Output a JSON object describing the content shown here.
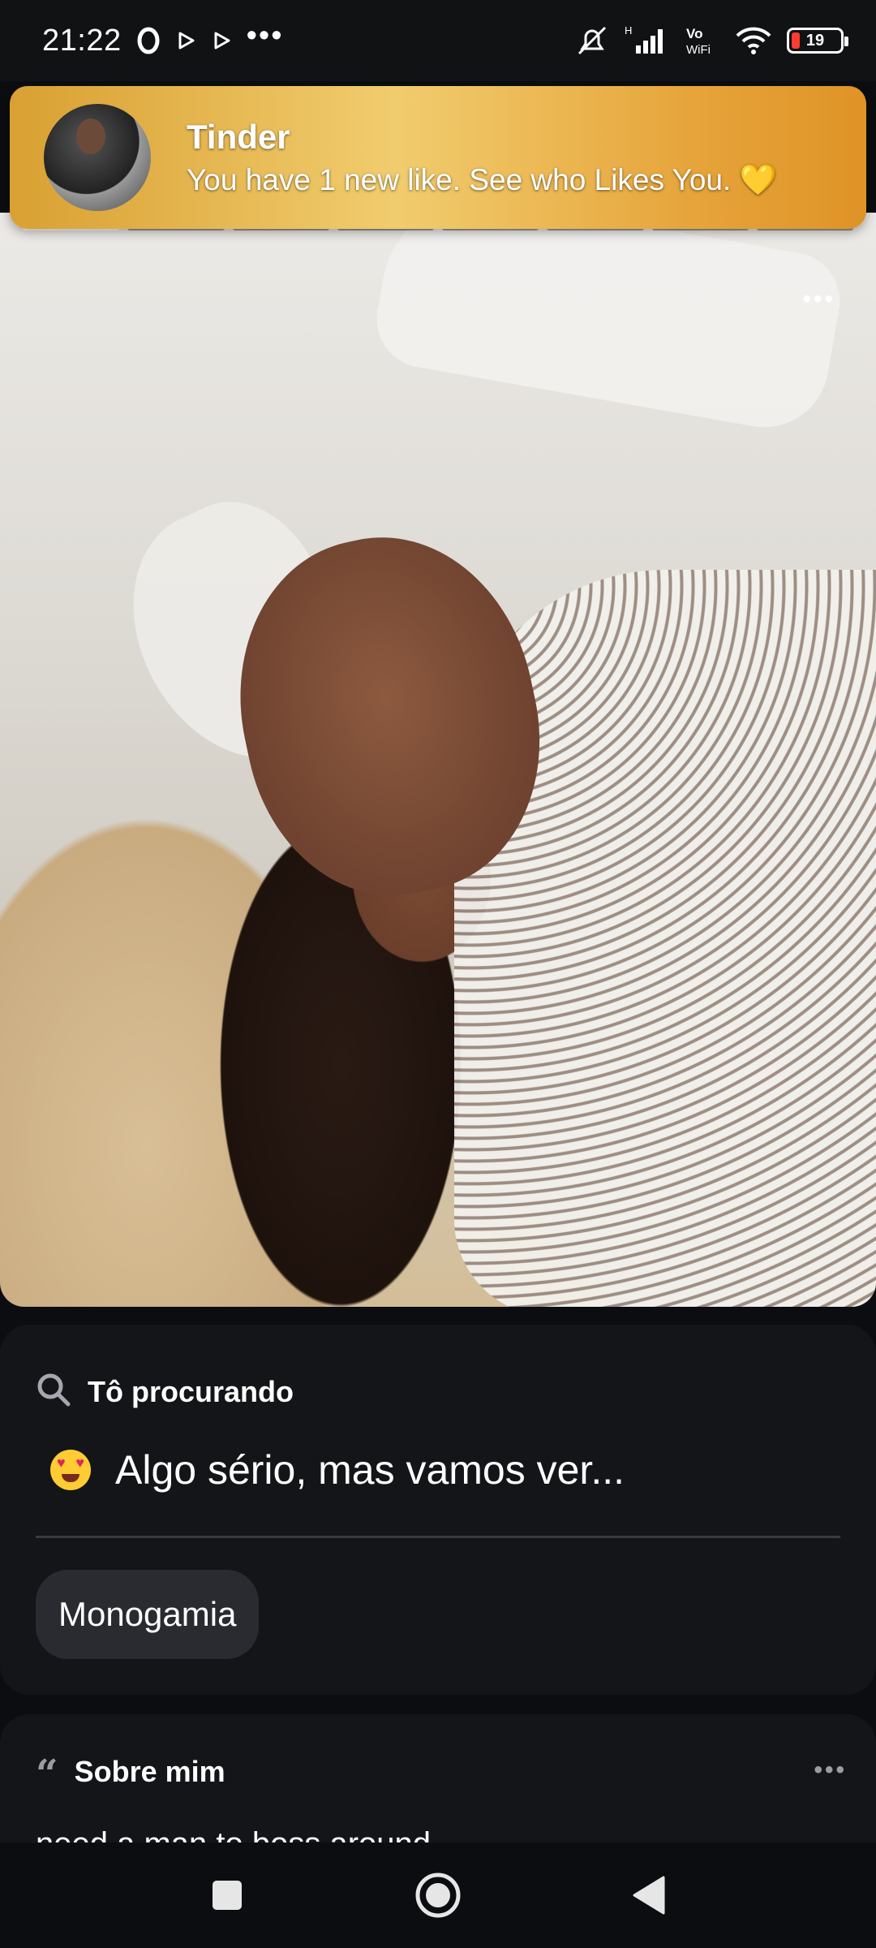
{
  "status_bar": {
    "time": "21:22",
    "battery": "19",
    "network": "H",
    "volte": "Vo WiFi",
    "overflow": "•••"
  },
  "notification": {
    "app": "Tinder",
    "message": "You have 1 new like. See who Likes You. 💛"
  },
  "photo": {
    "more_label": "•••",
    "photo_count": 8,
    "active_index": 0
  },
  "looking_for": {
    "label": "Tô procurando",
    "value": "Algo sério, mas vamos ver...",
    "chip": "Monogamia"
  },
  "about": {
    "label": "Sobre mim",
    "text": "need a man to boss around",
    "more_label": "•••"
  },
  "colors": {
    "background": "#0c0d10",
    "card": "#141518",
    "chip": "#2a2b30",
    "notification_gold": "#f1cc6e"
  },
  "icons": [
    "opera-icon",
    "play-icon",
    "play-icon",
    "mute-icon",
    "signal-icon",
    "wifi-icon",
    "battery-icon",
    "search-icon",
    "heart-eyes-emoji",
    "quote-icon",
    "recents-icon",
    "home-icon",
    "back-icon"
  ]
}
